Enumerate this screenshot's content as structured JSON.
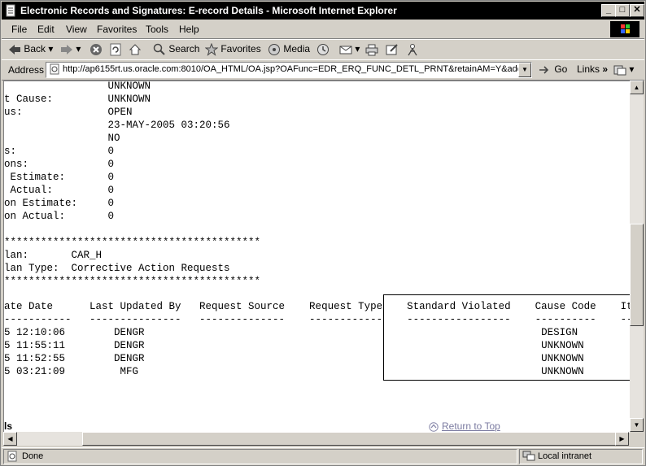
{
  "window": {
    "title": "Electronic Records and Signatures: E-record Details - Microsoft Internet Explorer",
    "minimize": "_",
    "maximize": "□",
    "close": "✕"
  },
  "menu": [
    "File",
    "Edit",
    "View",
    "Favorites",
    "Tools",
    "Help"
  ],
  "toolbar": {
    "back": "Back",
    "search": "Search",
    "favorites": "Favorites",
    "media": "Media"
  },
  "address": {
    "label": "Address",
    "url": "http://ap6155rt.us.oracle.com:8010/OA_HTML/OA.jsp?OAFunc=EDR_ERQ_FUNC_DETL_PRNT&retainAM=Y&addBre",
    "go": "Go",
    "links": "Links"
  },
  "content": {
    "lines": [
      "                 UNKNOWN",
      "t Cause:         UNKNOWN",
      "us:              OPEN",
      "                 23-MAY-2005 03:20:56",
      "                 NO",
      "s:               0",
      "ons:             0",
      " Estimate:       0",
      " Actual:         0",
      "on Estimate:     0",
      "on Actual:       0",
      "",
      "******************************************",
      "lan:       CAR_H",
      "lan Type:  Corrective Action Requests",
      "******************************************"
    ],
    "table_header": "ate Date      Last Updated By   Request Source    Request Type    Standard Violated    Cause Code    Item",
    "table_rule": "-----------   ---------------   --------------    ------------    -----------------    ----------    ----",
    "table_rows": [
      "5 12:10:06        DENGR                                                                 DESIGN",
      "5 11:55:11        DENGR                                                                 UNKNOWN",
      "5 11:52:55        DENGR                                                                 UNKNOWN",
      "5 03:21:09         MFG                                                                  UNKNOWN"
    ],
    "bottom_cut": "ls",
    "return_to_top": "Return to Top"
  },
  "status": {
    "text": "Done",
    "zone": "Local intranet"
  }
}
